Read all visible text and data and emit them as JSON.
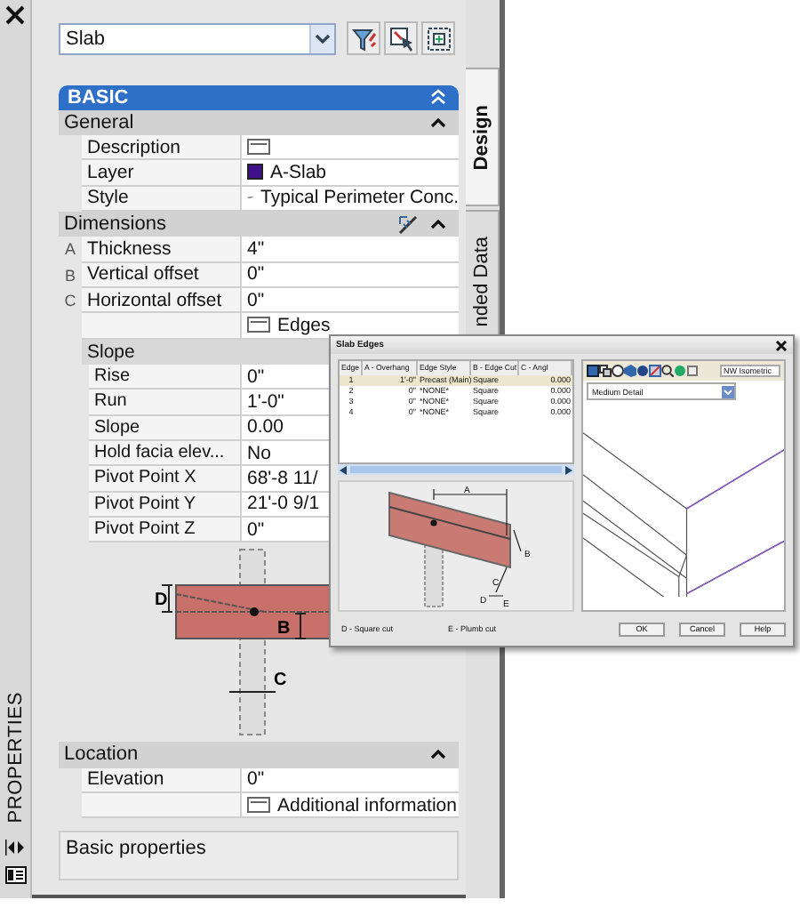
{
  "side_strip": {
    "title": "PROPERTIES"
  },
  "object_select": {
    "value": "Slab"
  },
  "section": {
    "title": "BASIC",
    "expanded": true
  },
  "groups": [
    {
      "title": "General",
      "expanded": true,
      "tool": false,
      "rows": [
        {
          "kind": "worksheet",
          "label": "Description"
        },
        {
          "kind": "layer",
          "label": "Layer",
          "value": "A-Slab"
        },
        {
          "kind": "style",
          "label": "Style",
          "value": "Typical Perimeter Conc."
        }
      ]
    },
    {
      "title": "Dimensions",
      "expanded": true,
      "tool": true,
      "rows": [
        {
          "kind": "text",
          "marker": "A",
          "label": "Thickness",
          "value": "4\""
        },
        {
          "kind": "text",
          "marker": "B",
          "label": "Vertical offset",
          "value": "0\""
        },
        {
          "kind": "text",
          "marker": "C",
          "label": "Horizontal offset",
          "value": "0\""
        },
        {
          "kind": "worksheet",
          "value": "Edges"
        },
        {
          "kind": "subgroup",
          "label": "Slope",
          "children": [
            {
              "kind": "text",
              "label": "Rise",
              "value": "0\""
            },
            {
              "kind": "text",
              "label": "Run",
              "value": "1'-0\""
            },
            {
              "kind": "text",
              "label": "Slope",
              "value": "0.00"
            },
            {
              "kind": "text",
              "label": "Hold facia elev...",
              "value": "No"
            },
            {
              "kind": "text",
              "label": "Pivot Point X",
              "value": "68'-8 11/"
            },
            {
              "kind": "text",
              "label": "Pivot Point Y",
              "value": "21'-0 9/1"
            },
            {
              "kind": "text",
              "label": "Pivot Point Z",
              "value": "0\""
            }
          ]
        },
        {
          "kind": "illustration",
          "labels": [
            "D",
            "B",
            "C"
          ]
        }
      ]
    },
    {
      "title": "Location",
      "expanded": true,
      "tool": false,
      "rows": [
        {
          "kind": "text",
          "label": "Elevation",
          "value": "0\""
        },
        {
          "kind": "worksheet",
          "value": "Additional information"
        }
      ]
    }
  ],
  "description": "Basic properties",
  "tabs": [
    {
      "label": "Design",
      "selected": true
    },
    {
      "label": "nded Data",
      "selected": false
    }
  ],
  "dialog": {
    "title": "Slab Edges",
    "columns": [
      "Edge",
      "A - Overhang",
      "Edge Style",
      "B - Edge Cut",
      "C - Angl"
    ],
    "rows": [
      {
        "cells": [
          "1",
          "1'-0\"",
          "Precast (Main)",
          "Square",
          "0.000"
        ],
        "selected": true
      },
      {
        "cells": [
          "2",
          "0\"",
          "*NONE*",
          "Square",
          "0.000"
        ],
        "selected": false
      },
      {
        "cells": [
          "3",
          "0\"",
          "*NONE*",
          "Square",
          "0.000"
        ],
        "selected": false
      },
      {
        "cells": [
          "4",
          "0\"",
          "*NONE*",
          "Square",
          "0.000"
        ],
        "selected": false
      }
    ],
    "diagram_labels": [
      "A",
      "B",
      "C",
      "D",
      "E"
    ],
    "view": "NW Isometric",
    "detail": "Medium Detail",
    "notes": [
      "D - Square cut",
      "E - Plumb cut"
    ],
    "buttons": [
      "OK",
      "Cancel",
      "Help"
    ]
  }
}
